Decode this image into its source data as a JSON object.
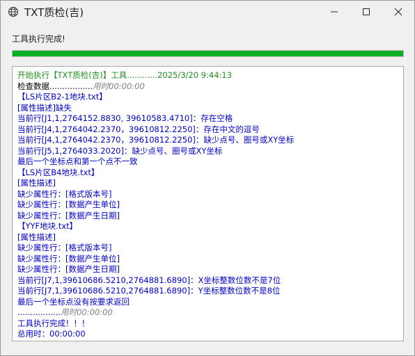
{
  "window": {
    "title": "TXT质检(吉)",
    "icon": "globe-icon",
    "controls": {
      "minimize": "minimize-icon",
      "maximize": "maximize-icon",
      "close": "close-icon"
    }
  },
  "status": {
    "text": "工具执行完成!"
  },
  "progress": {
    "percent": 100,
    "color": "#06b025"
  },
  "log": {
    "lines": [
      {
        "text": "开始执行【TXT质检(吉)】工具............2025/3/20 9:44:13",
        "time": "",
        "style": "green"
      },
      {
        "text": "检查数据.................",
        "time": "用时00:00:00",
        "style": "black"
      },
      {
        "text": "【LS片区B2-1地块.txt】",
        "time": "",
        "style": "blue"
      },
      {
        "text": "[属性描述]缺失",
        "time": "",
        "style": "blue"
      },
      {
        "text": "当前行[J1,1,2764152.8830, 39610583.4710]：存在空格",
        "time": "",
        "style": "blue"
      },
      {
        "text": "当前行[J4,1,2764042.2370，39610812.2250]：存在中文的逗号",
        "time": "",
        "style": "blue"
      },
      {
        "text": "当前行[J4,1,2764042.2370，39610812.2250]：缺少点号、圈号或XY坐标",
        "time": "",
        "style": "blue"
      },
      {
        "text": "当前行[J5,1,2764033.2020]：缺少点号、圈号或XY坐标",
        "time": "",
        "style": "blue"
      },
      {
        "text": "最后一个坐标点和第一个点不一致",
        "time": "",
        "style": "blue"
      },
      {
        "text": "【LS片区B4地块.txt】",
        "time": "",
        "style": "blue"
      },
      {
        "text": "[属性描述]",
        "time": "",
        "style": "blue"
      },
      {
        "text": "缺少属性行：[格式版本号]",
        "time": "",
        "style": "blue"
      },
      {
        "text": "缺少属性行：[数据产生单位]",
        "time": "",
        "style": "blue"
      },
      {
        "text": "缺少属性行：[数据产生日期]",
        "time": "",
        "style": "blue"
      },
      {
        "text": "【YYF地块.txt】",
        "time": "",
        "style": "blue"
      },
      {
        "text": "[属性描述]",
        "time": "",
        "style": "blue"
      },
      {
        "text": "缺少属性行：[格式版本号]",
        "time": "",
        "style": "blue"
      },
      {
        "text": "缺少属性行：[数据产生单位]",
        "time": "",
        "style": "blue"
      },
      {
        "text": "缺少属性行：[数据产生日期]",
        "time": "",
        "style": "blue"
      },
      {
        "text": "当前行[J7,1,39610686.5210,2764881.6890]：X坐标整数位数不是7位",
        "time": "",
        "style": "blue"
      },
      {
        "text": "当前行[J7,1,39610686.5210,2764881.6890]：Y坐标整数位数不是8位",
        "time": "",
        "style": "blue"
      },
      {
        "text": "最后一个坐标点没有按要求返回",
        "time": "",
        "style": "blue"
      },
      {
        "text": ".................",
        "time": "用时00:00:00",
        "style": "blue"
      },
      {
        "text": "工具执行完成！！！",
        "time": "",
        "style": "blue"
      },
      {
        "text": "总用时：00:00:00",
        "time": "",
        "style": "blue"
      }
    ]
  }
}
